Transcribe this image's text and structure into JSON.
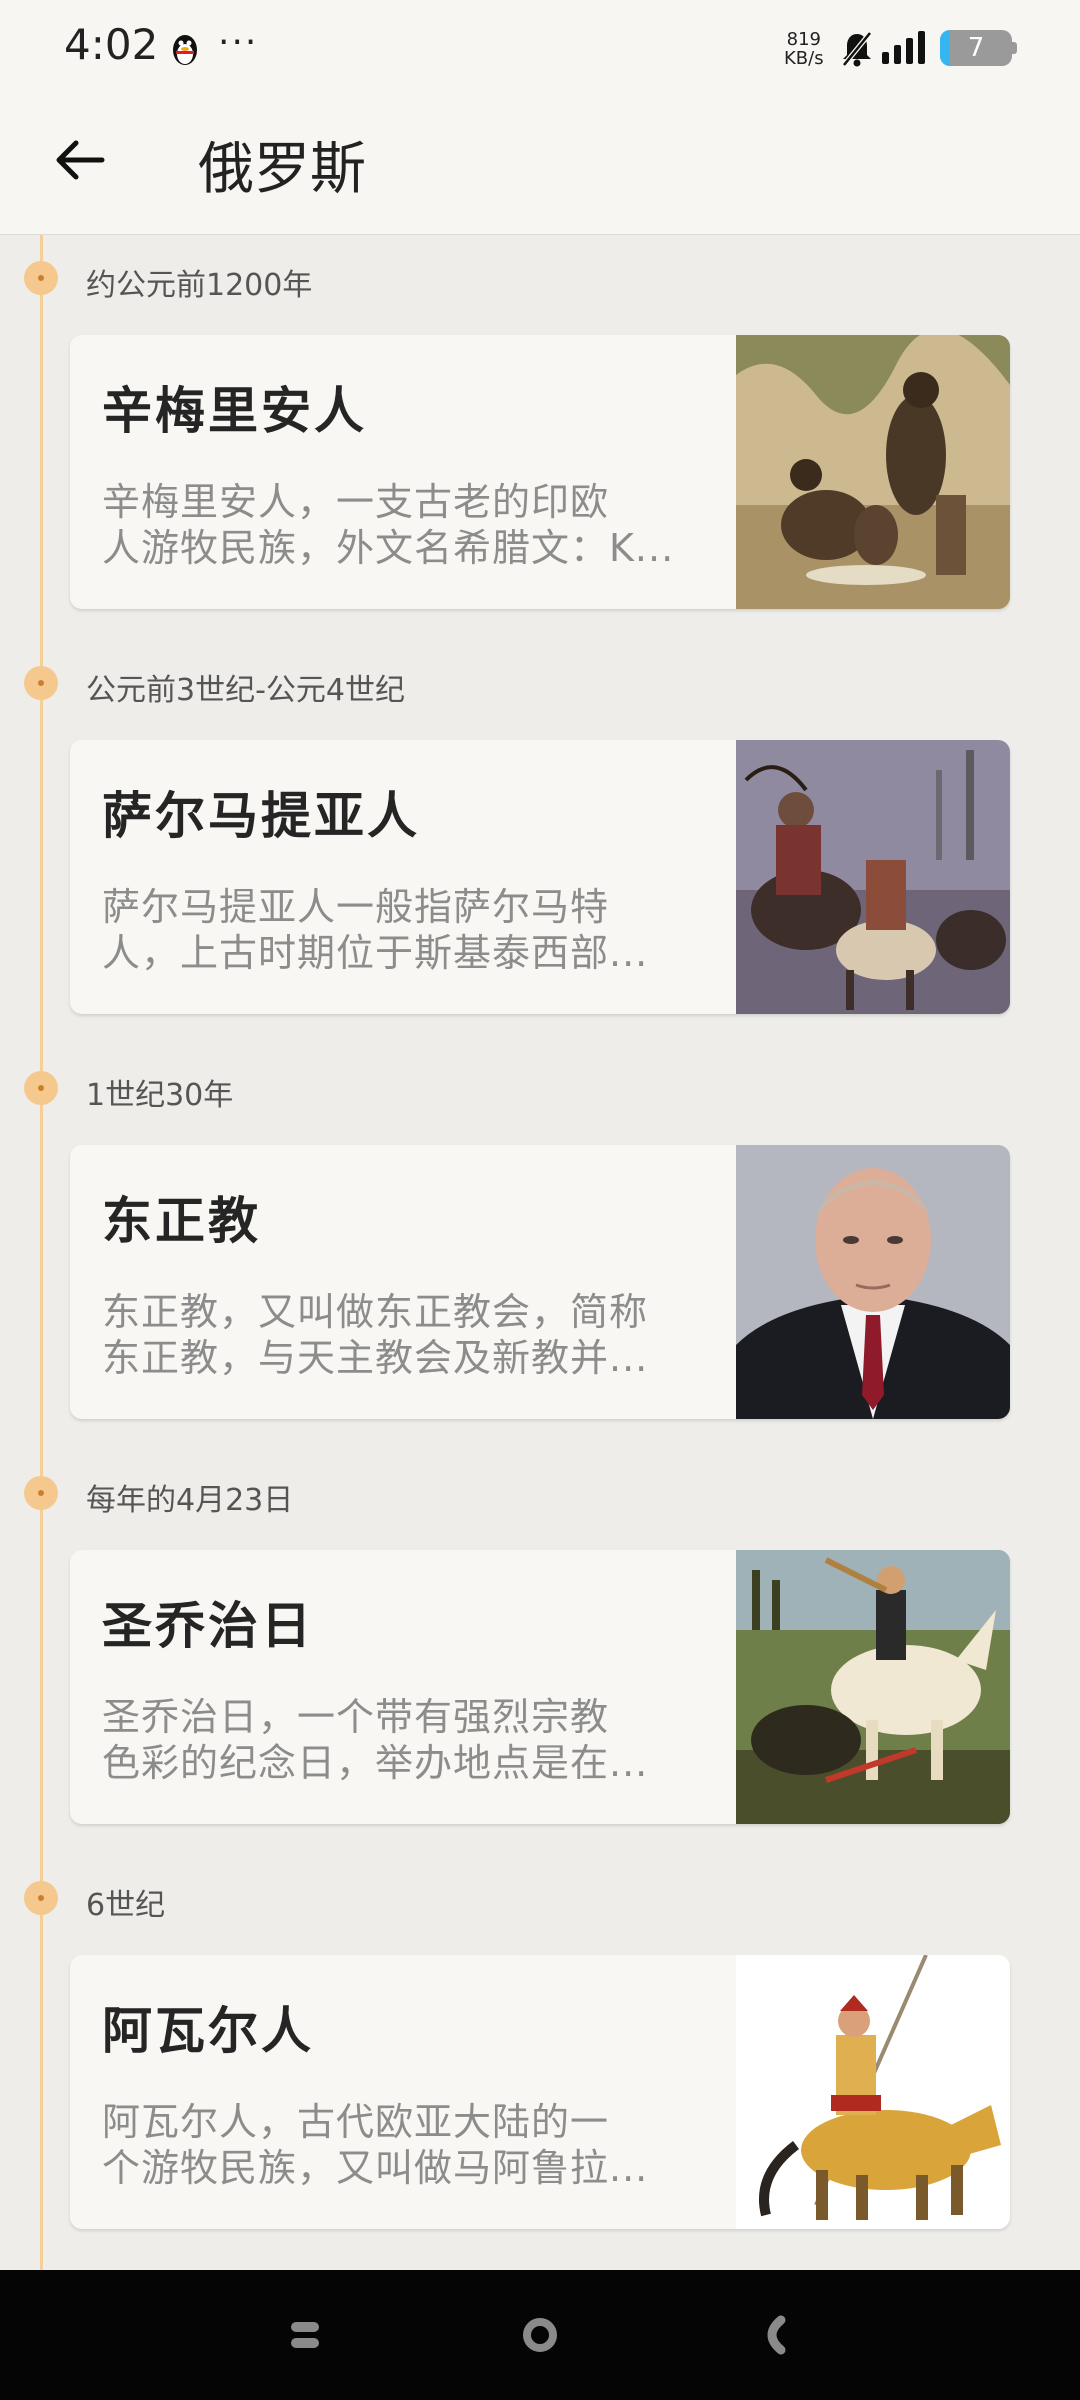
{
  "status_bar": {
    "time": "4:02",
    "more_indicator": "···",
    "net_speed_value": "819",
    "net_speed_unit": "KB/s",
    "battery_level": "7",
    "icons": [
      "qq-penguin-icon",
      "bell-muted-icon",
      "signal-icon",
      "battery-icon"
    ]
  },
  "header": {
    "title": "俄罗斯",
    "back_icon": "arrow-left-icon"
  },
  "timeline": {
    "accent_color": "#f5c98d",
    "items": [
      {
        "date": "约公元前1200年",
        "title": "辛梅里安人",
        "desc_line1": "辛梅里安人，一支古老的印欧",
        "desc_line2": "人游牧民族，外文名希腊文：K...",
        "image": "nomads-illustration"
      },
      {
        "date": "公元前3世纪-公元4世纪",
        "title": "萨尔马提亚人",
        "desc_line1": "萨尔马提亚人一般指萨尔马特",
        "desc_line2": "人，上古时期位于斯基泰西部...",
        "image": "mounted-archers-battle"
      },
      {
        "date": "1世纪30年",
        "title": "东正教",
        "desc_line1": "东正教，又叫做东正教会，简称",
        "desc_line2": "东正教，与天主教会及新教并...",
        "image": "portrait-man-in-suit"
      },
      {
        "date": "每年的4月23日",
        "title": "圣乔治日",
        "desc_line1": "圣乔治日，一个带有强烈宗教",
        "desc_line2": "色彩的纪念日，举办地点是在...",
        "image": "saint-george-and-dragon-painting"
      },
      {
        "date": "6世纪",
        "title": "阿瓦尔人",
        "desc_line1": "阿瓦尔人，古代欧亚大陆的一",
        "desc_line2": "个游牧民族，又叫做马阿鲁拉...",
        "image": "mounted-warrior-with-lance"
      }
    ]
  },
  "nav_bar": {
    "buttons": [
      "recents-button",
      "home-button",
      "back-button"
    ]
  }
}
